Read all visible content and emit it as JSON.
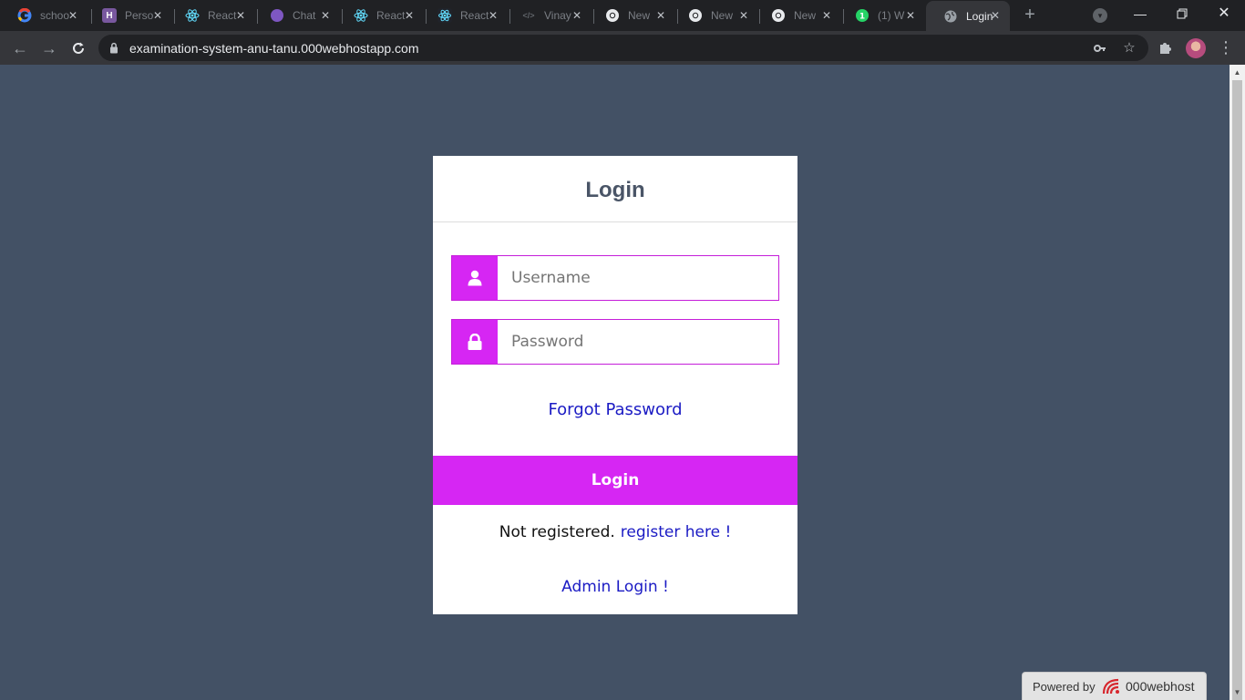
{
  "browser": {
    "tabs": [
      {
        "title": "schoo",
        "icon": "google-icon",
        "color": "#4285f4"
      },
      {
        "title": "Perso",
        "icon": "heroku-icon",
        "color": "#79589f"
      },
      {
        "title": "React",
        "icon": "react-icon",
        "color": "#61dafb"
      },
      {
        "title": "Chat",
        "icon": "chat-icon",
        "color": "#7e57c2"
      },
      {
        "title": "React",
        "icon": "react-icon",
        "color": "#61dafb"
      },
      {
        "title": "React",
        "icon": "react-icon",
        "color": "#61dafb"
      },
      {
        "title": "Vinay",
        "icon": "code-icon",
        "color": "#8ab4f8"
      },
      {
        "title": "New",
        "icon": "chrome-icon",
        "color": "#e8eaed"
      },
      {
        "title": "New",
        "icon": "chrome-icon",
        "color": "#e8eaed"
      },
      {
        "title": "New",
        "icon": "chrome-icon",
        "color": "#e8eaed"
      },
      {
        "title": "(1) W",
        "icon": "whatsapp-icon",
        "color": "#25d366"
      },
      {
        "title": "Login",
        "icon": "globe-icon",
        "color": "#9aa0a6",
        "active": true
      }
    ],
    "url": "examination-system-anu-tanu.000webhostapp.com"
  },
  "login": {
    "title": "Login",
    "username_placeholder": "Username",
    "password_placeholder": "Password",
    "forgot_password": "Forgot Password",
    "login_button": "Login",
    "not_registered": "Not registered.",
    "register_link": "register here !",
    "admin_login": "Admin Login !"
  },
  "footer": {
    "powered_by": "Powered by",
    "brand": "000webhost"
  },
  "colors": {
    "page_bg": "#435165",
    "accent": "#d626f3",
    "link": "#1b1bc4"
  }
}
